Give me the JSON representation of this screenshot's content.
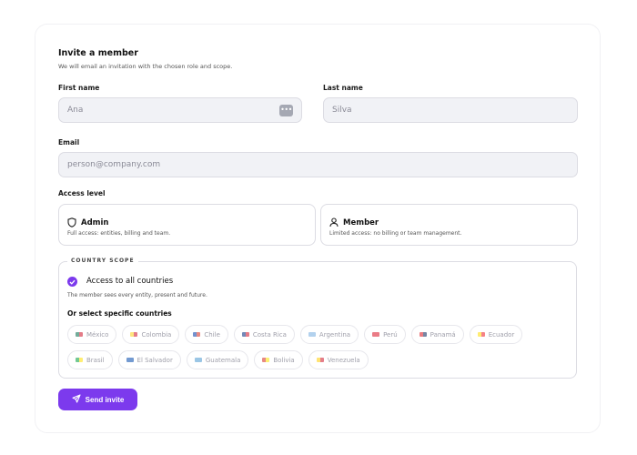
{
  "form": {
    "title": "Invite a member",
    "subtitle": "We will email an invitation with the chosen role and scope.",
    "first_name": {
      "label": "First name",
      "value": "Ana"
    },
    "last_name": {
      "label": "Last name",
      "value": "Silva"
    },
    "email": {
      "label": "Email",
      "placeholder": "person@company.com"
    },
    "access_level": {
      "label": "Access level",
      "options": [
        {
          "name": "Admin",
          "description": "Full access: entities, billing and team.",
          "icon": "shield-icon"
        },
        {
          "name": "Member",
          "description": "Limited access: no billing or team management.",
          "icon": "user-icon"
        }
      ]
    },
    "country_scope": {
      "legend": "COUNTRY SCOPE",
      "all_label": "Access to all countries",
      "all_description": "The member sees every entity, present and future.",
      "all_checked": true,
      "specific_label": "Or select specific countries",
      "countries": [
        {
          "name": "México",
          "colors": [
            "#006847",
            "#ce1126"
          ]
        },
        {
          "name": "Colombia",
          "colors": [
            "#fcd116",
            "#ce1126"
          ]
        },
        {
          "name": "Chile",
          "colors": [
            "#0039a6",
            "#d52b1e"
          ]
        },
        {
          "name": "Costa Rica",
          "colors": [
            "#002b7f",
            "#ce1126"
          ]
        },
        {
          "name": "Argentina",
          "colors": [
            "#74acdf",
            "#74acdf"
          ]
        },
        {
          "name": "Perú",
          "colors": [
            "#d91023",
            "#d91023"
          ]
        },
        {
          "name": "Panamá",
          "colors": [
            "#da121a",
            "#072357"
          ]
        },
        {
          "name": "Ecuador",
          "colors": [
            "#ffdd00",
            "#ed1c24"
          ]
        },
        {
          "name": "Brasil",
          "colors": [
            "#009c3b",
            "#ffdf00"
          ]
        },
        {
          "name": "El Salvador",
          "colors": [
            "#0047ab",
            "#0047ab"
          ]
        },
        {
          "name": "Guatemala",
          "colors": [
            "#4997d0",
            "#4997d0"
          ]
        },
        {
          "name": "Bolivia",
          "colors": [
            "#d52b1e",
            "#f9e300"
          ]
        },
        {
          "name": "Venezuela",
          "colors": [
            "#ffcc00",
            "#cf142b"
          ]
        }
      ]
    },
    "submit_label": "Send invite"
  },
  "colors": {
    "accent": "#7c3aed",
    "input_bg": "#f1f2f6",
    "border": "#dcdce3"
  }
}
